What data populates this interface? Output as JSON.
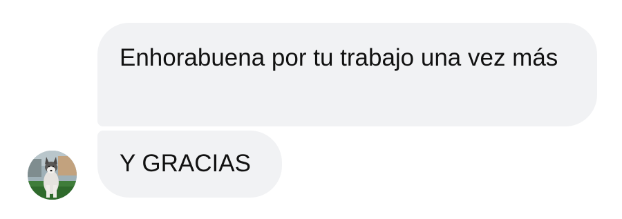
{
  "messages": [
    {
      "text": "Enhorabuena por tu trabajo una vez más"
    },
    {
      "text": "Y GRACIAS"
    }
  ],
  "avatar": {
    "icon": "husky-dog-photo-icon"
  },
  "colors": {
    "bubble_background": "#f1f2f4",
    "text": "#111111",
    "background": "#ffffff"
  }
}
